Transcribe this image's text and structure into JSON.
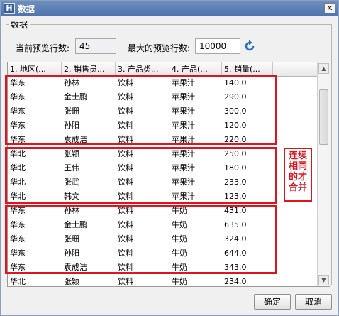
{
  "window": {
    "title": "数据",
    "app_icon_glyph": "H"
  },
  "group": {
    "label": "数据"
  },
  "preview": {
    "current_rows_label": "当前预览行数:",
    "current_rows_value": "45",
    "max_rows_label": "最大的预览行数:",
    "max_rows_value": "10000"
  },
  "table": {
    "columns": [
      "1. 地区(...",
      "2. 销售员...",
      "3. 产品类...",
      "4. 产品(...",
      "5. 销量(..."
    ],
    "rows": [
      [
        "华东",
        "孙林",
        "饮料",
        "苹果汁",
        "140.0"
      ],
      [
        "华东",
        "金士鹏",
        "饮料",
        "苹果汁",
        "290.0"
      ],
      [
        "华东",
        "张珊",
        "饮料",
        "苹果汁",
        "300.0"
      ],
      [
        "华东",
        "孙阳",
        "饮料",
        "苹果汁",
        "120.0"
      ],
      [
        "华东",
        "袁成洁",
        "饮料",
        "苹果汁",
        "220.0"
      ],
      [
        "华北",
        "张颖",
        "饮料",
        "苹果汁",
        "250.0"
      ],
      [
        "华北",
        "王伟",
        "饮料",
        "苹果汁",
        "180.0"
      ],
      [
        "华北",
        "张武",
        "饮料",
        "苹果汁",
        "233.0"
      ],
      [
        "华北",
        "韩文",
        "饮料",
        "苹果汁",
        "123.0"
      ],
      [
        "华东",
        "孙林",
        "饮料",
        "牛奶",
        "431.0"
      ],
      [
        "华东",
        "金士鹏",
        "饮料",
        "牛奶",
        "635.0"
      ],
      [
        "华东",
        "张珊",
        "饮料",
        "牛奶",
        "324.0"
      ],
      [
        "华东",
        "孙阳",
        "饮料",
        "牛奶",
        "644.0"
      ],
      [
        "华东",
        "袁成洁",
        "饮料",
        "牛奶",
        "343.0"
      ],
      [
        "华北",
        "张颖",
        "饮料",
        "牛奶",
        "234.0"
      ]
    ]
  },
  "annotation": {
    "note": "连续相同的才合并",
    "color": "#e0141e"
  },
  "buttons": {
    "ok": "确定",
    "cancel": "取消"
  }
}
